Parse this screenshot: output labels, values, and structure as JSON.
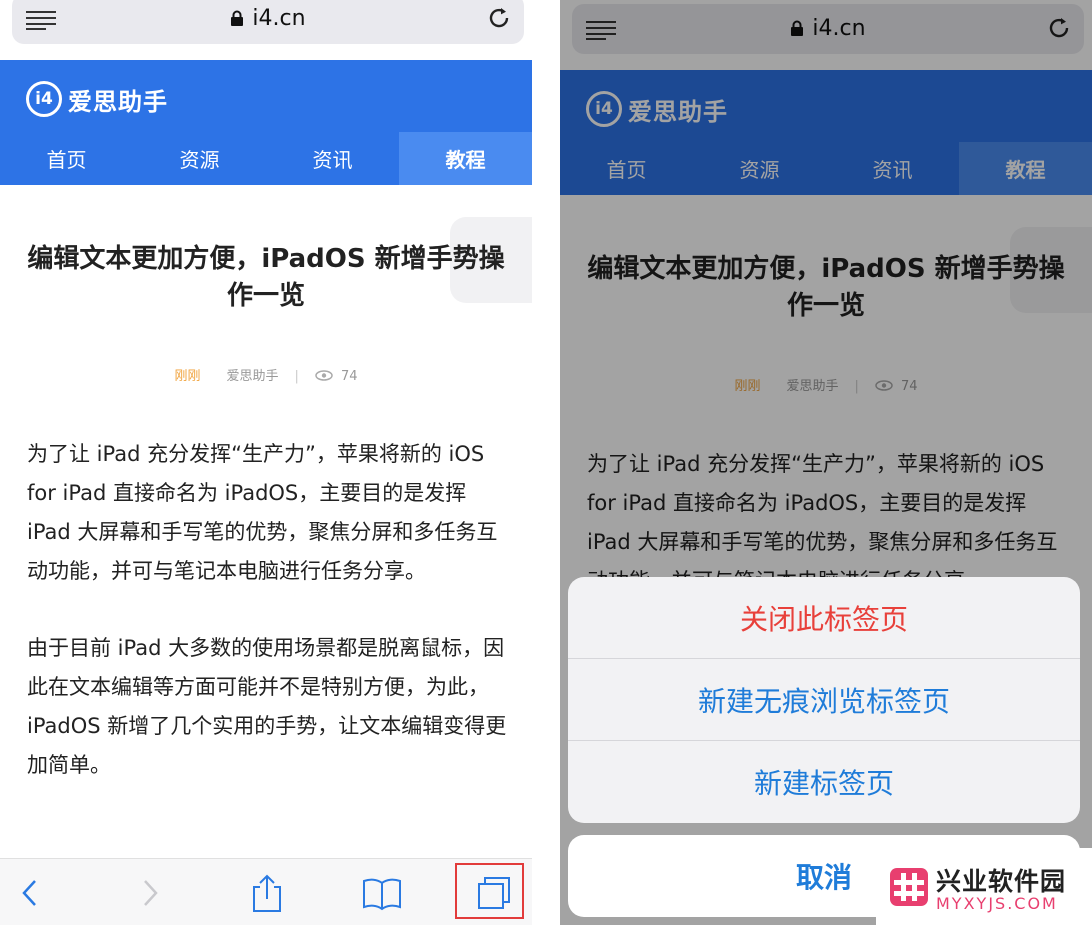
{
  "browser": {
    "domain": "i4.cn"
  },
  "site": {
    "logo_mark": "i4",
    "logo_text": "爱思助手",
    "nav": [
      "首页",
      "资源",
      "资讯",
      "教程"
    ],
    "active_tab": "教程",
    "brand_color": "#2d73e6"
  },
  "article": {
    "title": "编辑文本更加方便，iPadOS 新增手势操作一览",
    "time": "刚刚",
    "author": "爱思助手",
    "views": "74",
    "paragraphs": [
      "为了让 iPad 充分发挥“生产力”，苹果将新的 iOS for iPad 直接命名为 iPadOS，主要目的是发挥 iPad 大屏幕和手写笔的优势，聚焦分屏和多任务互动功能，并可与笔记本电脑进行任务分享。",
      "由于目前 iPad 大多数的使用场景都是脱离鼠标，因此在文本编辑等方面可能并不是特别方便，为此，iPadOS 新增了几个实用的手势，让文本编辑变得更加简单。"
    ]
  },
  "toolbar": {
    "icons": [
      "back-icon",
      "forward-icon",
      "share-icon",
      "bookmarks-icon",
      "tabs-icon"
    ]
  },
  "action_sheet": {
    "close_tab": "关闭此标签页",
    "new_private_tab": "新建无痕浏览标签页",
    "new_tab": "新建标签页",
    "cancel": "取消",
    "accent_color": "#1f7cd9",
    "destructive_color": "#e8403a"
  },
  "watermark": {
    "title": "兴业软件园",
    "url": "MYXYJS.COM"
  }
}
